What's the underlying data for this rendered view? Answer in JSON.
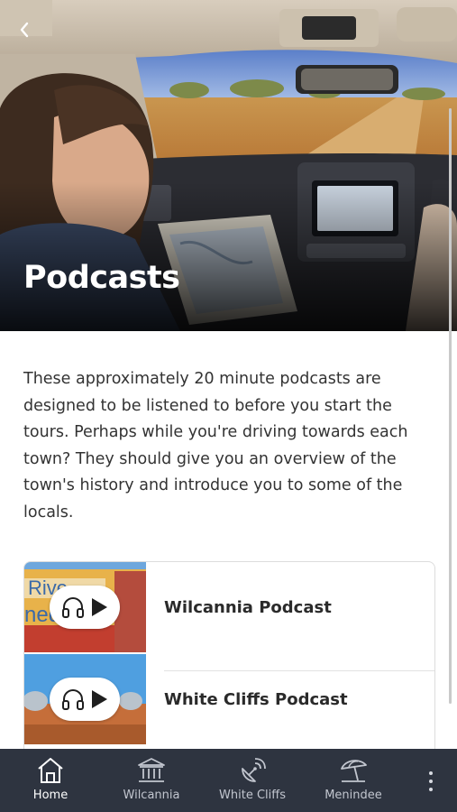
{
  "header": {
    "title": "Podcasts",
    "back_icon": "chevron-left-icon"
  },
  "intro": {
    "text": "These approximately 20 minute podcasts are designed to be listened to before you start the tours. Perhaps while you're driving towards each town? They should give you an overview of the town's history and introduce you to some of the locals."
  },
  "podcasts": [
    {
      "title": "Wilcannia Podcast",
      "icons": [
        "headphones-icon",
        "play-icon"
      ]
    },
    {
      "title": "White Cliffs Podcast",
      "icons": [
        "headphones-icon",
        "play-icon"
      ]
    }
  ],
  "nav": {
    "items": [
      {
        "label": "Home",
        "icon": "home-icon",
        "active": true
      },
      {
        "label": "Wilcannia",
        "icon": "bank-icon",
        "active": false
      },
      {
        "label": "White Cliffs",
        "icon": "satellite-dish-icon",
        "active": false
      },
      {
        "label": "Menindee",
        "icon": "beach-umbrella-icon",
        "active": false
      }
    ],
    "more_icon": "more-vertical-icon"
  },
  "colors": {
    "nav_background": "#2e3440",
    "nav_label": "#c2c6cf",
    "nav_label_active": "#ffffff",
    "text": "#333333"
  }
}
